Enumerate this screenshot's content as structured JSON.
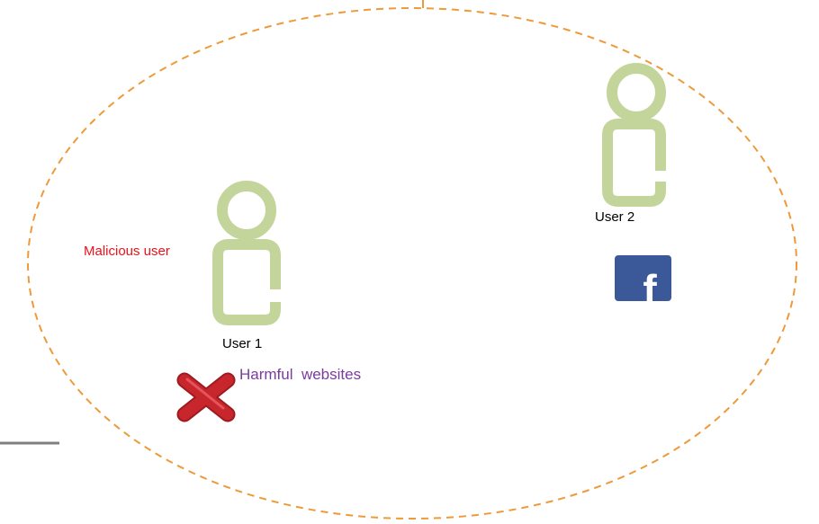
{
  "diagram": {
    "colors": {
      "boundary": "#EE9A3A",
      "user_figure": "#C3D59A",
      "malicious_label": "#E8121B",
      "harmful_label": "#7A3BA0",
      "deny_mark": "#C8262D",
      "facebook_brand": "#3B5998",
      "left_line": "#808080"
    },
    "users": [
      {
        "label": "User 1",
        "icon": "person-icon"
      },
      {
        "label": "User 2",
        "icon": "person-icon"
      }
    ],
    "malicious_label": "Malicious user",
    "harmful_label": "Harmful  websites",
    "icons": {
      "deny": "red-x-icon",
      "social": "facebook-icon",
      "facebook_letter": "f"
    }
  }
}
